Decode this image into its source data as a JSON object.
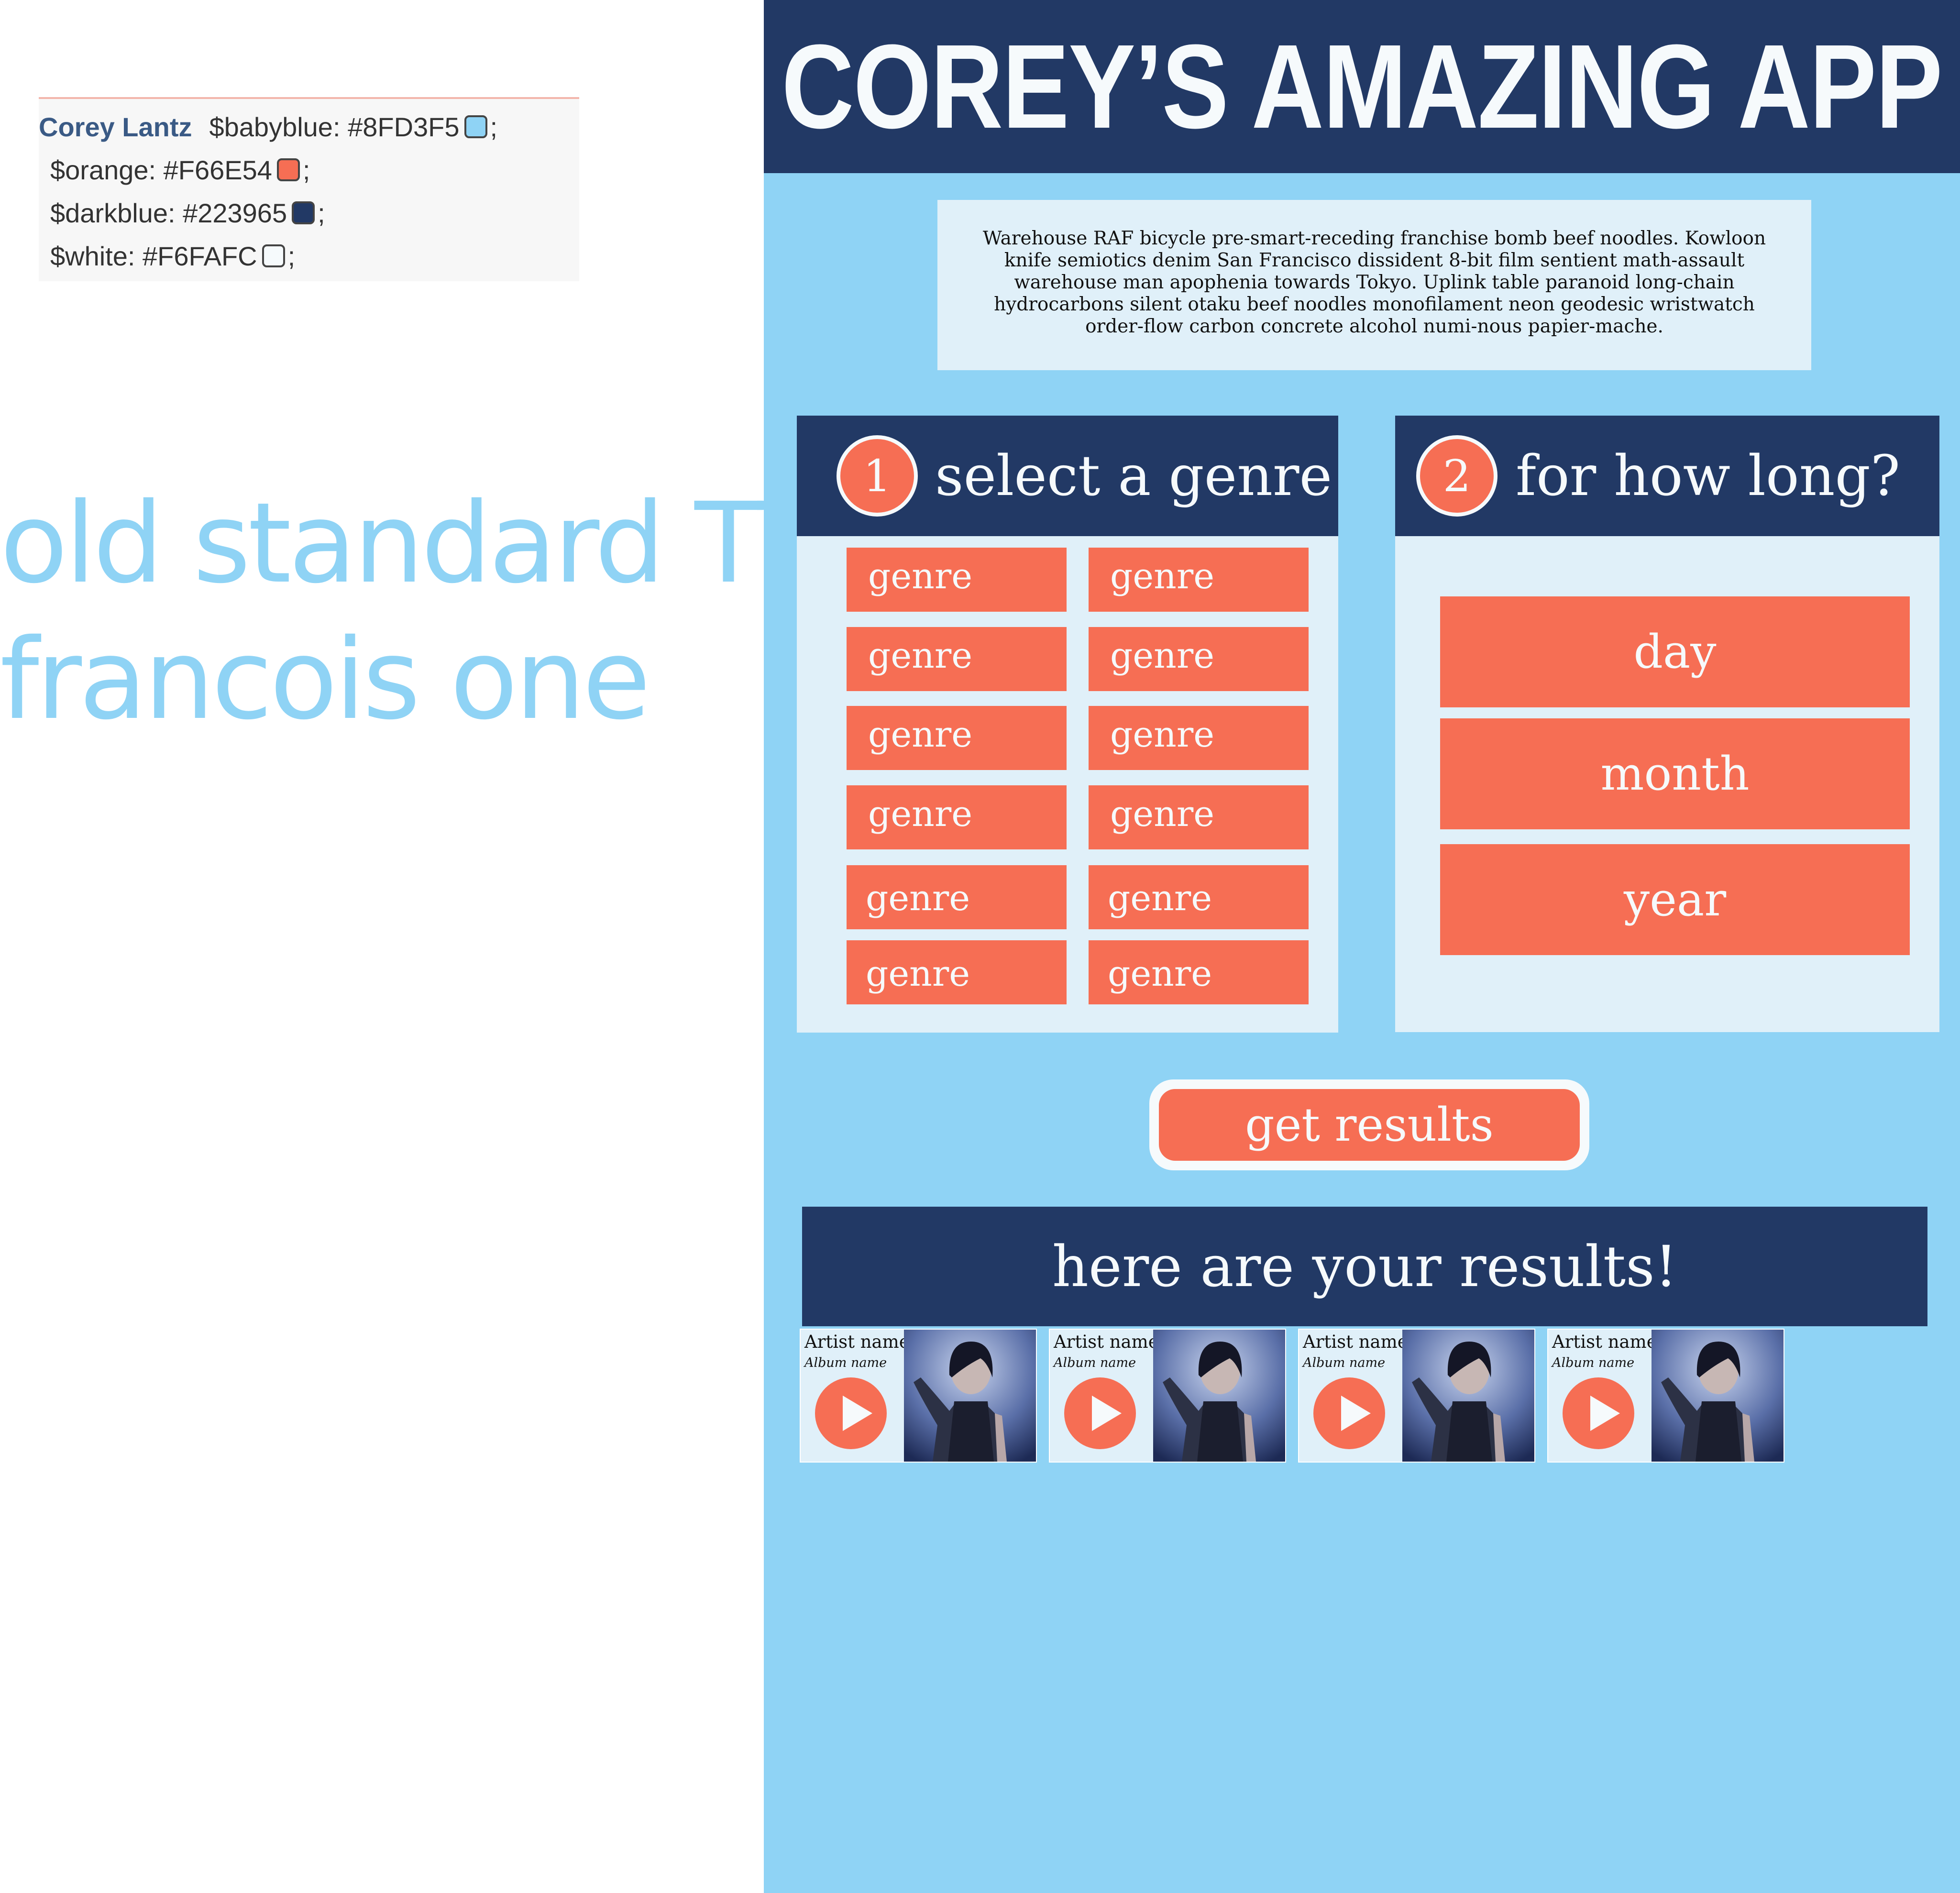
{
  "notes": {
    "author": "Corey Lantz",
    "palette": [
      {
        "label": "$babyblue: #8FD3F5",
        "color": "#8FD3F5"
      },
      {
        "label": "$orange: #F66E54",
        "color": "#F66E54"
      },
      {
        "label": "$darkblue: #223965",
        "color": "#223965"
      },
      {
        "label": "$white: #F6FAFC",
        "color": "#F6FAFC"
      }
    ],
    "semicolon": ";",
    "fonts": [
      "old standard TT",
      "francois one"
    ]
  },
  "app": {
    "title": "COREY’S AMAZING APP",
    "intro": "Warehouse RAF bicycle pre-smart-receding franchise bomb beef noodles. Kowloon knife semiotics denim San Francisco dissident 8-bit film sentient math-assault warehouse man apophenia towards Tokyo. Uplink table paranoid long-chain hydrocarbons silent otaku beef noodles monofilament neon geodesic wristwatch order-flow carbon concrete alcohol numi-nous papier-mache.",
    "genre_panel": {
      "step": "1",
      "title": "select a genre",
      "genres": [
        "genre",
        "genre",
        "genre",
        "genre",
        "genre",
        "genre",
        "genre",
        "genre",
        "genre",
        "genre",
        "genre",
        "genre"
      ]
    },
    "duration_panel": {
      "step": "2",
      "title": "for how long?",
      "options": [
        "day",
        "month",
        "year"
      ]
    },
    "get_results_label": "get results",
    "results_heading": "here are your results!",
    "results": [
      {
        "artist": "Artist name",
        "album": "Album name"
      },
      {
        "artist": "Artist name",
        "album": "Album name"
      },
      {
        "artist": "Artist name",
        "album": "Album name"
      },
      {
        "artist": "Artist name",
        "album": "Album name"
      }
    ]
  },
  "colors": {
    "babyblue": "#8FD3F5",
    "orange": "#F66E54",
    "darkblue": "#223965",
    "white": "#F6FAFC"
  }
}
